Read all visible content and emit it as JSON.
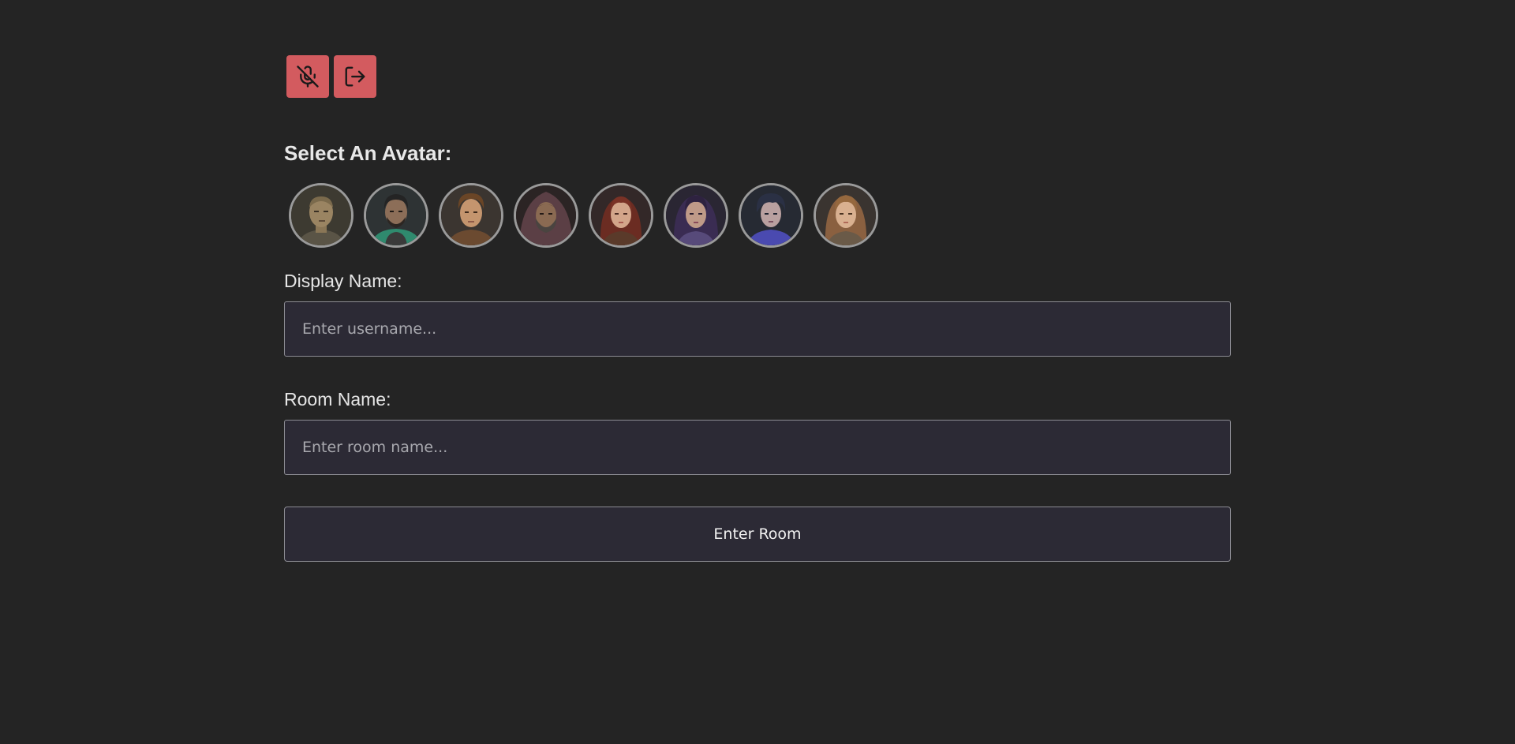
{
  "toolbar": {
    "mute_icon": "mic-off-icon",
    "leave_icon": "log-out-icon",
    "accent_color": "#d35b5f"
  },
  "avatar_section": {
    "title": "Select An Avatar:",
    "avatars": [
      {
        "id": "avatar-1"
      },
      {
        "id": "avatar-2"
      },
      {
        "id": "avatar-3"
      },
      {
        "id": "avatar-4"
      },
      {
        "id": "avatar-5"
      },
      {
        "id": "avatar-6"
      },
      {
        "id": "avatar-7"
      },
      {
        "id": "avatar-8"
      }
    ]
  },
  "form": {
    "display_name_label": "Display Name:",
    "display_name_placeholder": "Enter username...",
    "display_name_value": "",
    "room_name_label": "Room Name:",
    "room_name_placeholder": "Enter room name...",
    "room_name_value": "",
    "submit_label": "Enter Room"
  },
  "colors": {
    "background": "#242424",
    "input_background": "#2c2a35",
    "border": "#8c8c93"
  }
}
